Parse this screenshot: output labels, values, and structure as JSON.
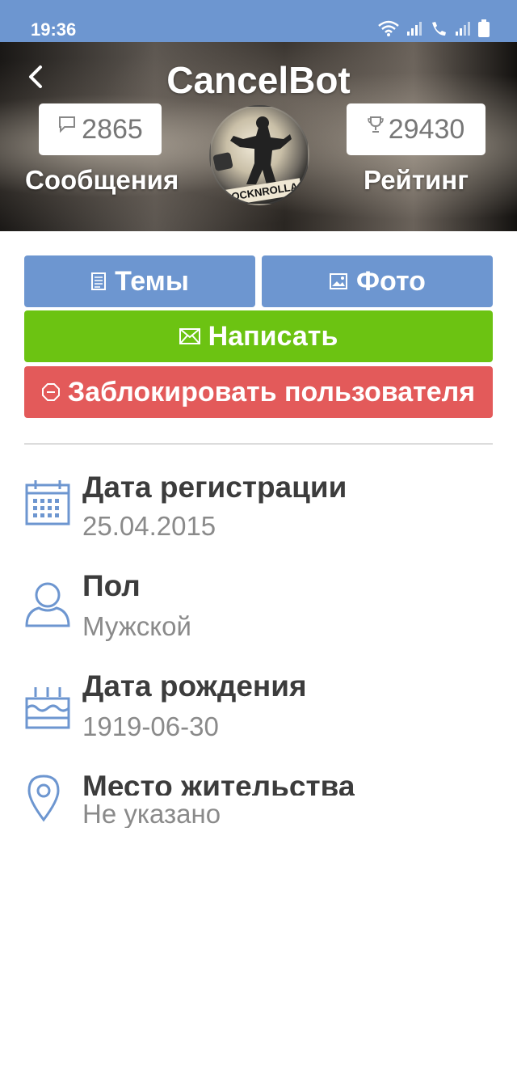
{
  "status_bar": {
    "time": "19:36"
  },
  "header": {
    "username": "CancelBot",
    "messages_count": "2865",
    "messages_label": "Сообщения",
    "rating_count": "29430",
    "rating_label": "Рейтинг",
    "avatar_text": "ROCKNROLLA"
  },
  "actions": {
    "topics_label": "Темы",
    "photo_label": "Фото",
    "write_label": "Написать",
    "block_label": "Заблокировать пользователя"
  },
  "info": [
    {
      "title": "Дата регистрации",
      "value": "25.04.2015",
      "icon": "calendar-icon"
    },
    {
      "title": "Пол",
      "value": "Мужской",
      "icon": "user-icon"
    },
    {
      "title": "Дата рождения",
      "value": "1919-06-30",
      "icon": "birthday-cake-icon"
    },
    {
      "title": "Место жительства",
      "value": "Не указано",
      "icon": "location-pin-icon"
    }
  ],
  "colors": {
    "accent_blue": "#6d96d0",
    "write_green": "#6cc312",
    "block_red": "#e35a5a"
  }
}
